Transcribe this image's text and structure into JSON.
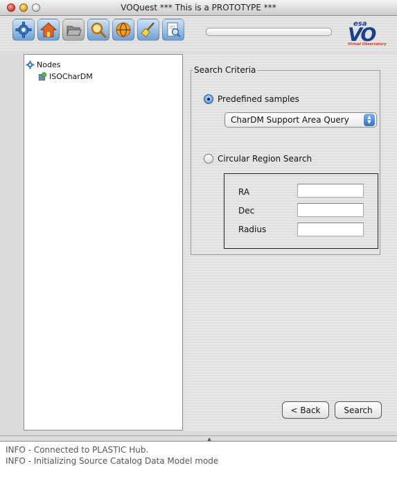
{
  "window": {
    "title": "VOQuest *** This is a PROTOTYPE ***"
  },
  "toolbar": {
    "buttons": [
      {
        "name": "settings",
        "icon": "gear-icon"
      },
      {
        "name": "home",
        "icon": "home-icon"
      },
      {
        "name": "load",
        "icon": "folder-icon"
      },
      {
        "name": "search",
        "icon": "magnifier-icon"
      },
      {
        "name": "connect",
        "icon": "network-globe-icon"
      },
      {
        "name": "clean",
        "icon": "broom-icon"
      },
      {
        "name": "analyze",
        "icon": "document-search-icon"
      }
    ],
    "progress_value": 0,
    "logo": {
      "small": "esa",
      "big": "VO",
      "caption": "Virtual Observatory"
    }
  },
  "tree": {
    "root_label": "Nodes",
    "children": [
      {
        "label": "ISOCharDM"
      }
    ]
  },
  "search": {
    "legend": "Search Criteria",
    "predefined_label": "Predefined samples",
    "predefined_selected": true,
    "dropdown_value": "CharDM Support Area Query",
    "circular_label": "Circular Region Search",
    "circular_selected": false,
    "ra_label": "RA",
    "ra_value": "",
    "dec_label": "Dec",
    "dec_value": "",
    "radius_label": "Radius",
    "radius_value": ""
  },
  "actions": {
    "back_label": "< Back",
    "search_label": "Search"
  },
  "log": {
    "lines": [
      "INFO - Connected to PLASTIC Hub.",
      "INFO - Initializing Source Catalog Data Model mode"
    ]
  },
  "colors": {
    "accent": "#3070b5",
    "logo_blue": "#1b3f8f",
    "logo_red": "#c0392b"
  }
}
